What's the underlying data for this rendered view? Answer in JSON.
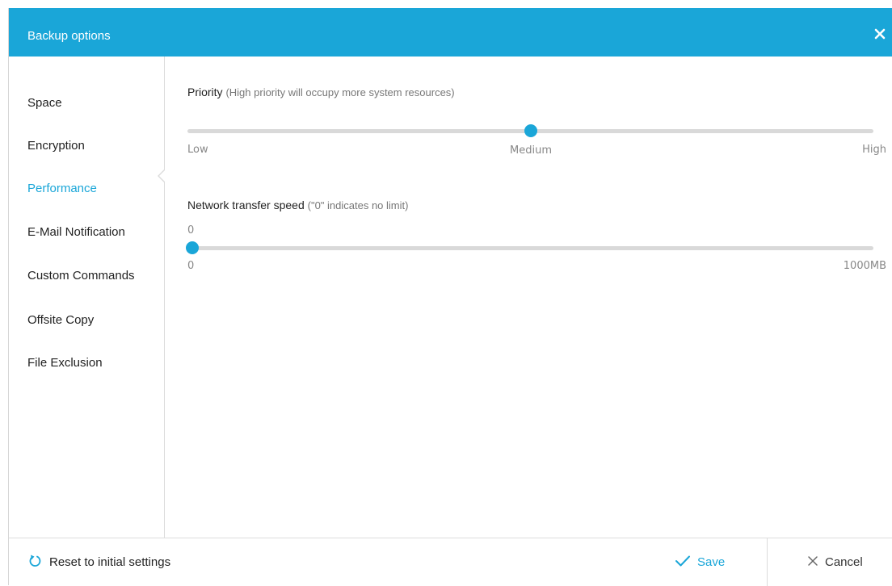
{
  "dialog": {
    "title": "Backup options",
    "close_icon": "close-icon"
  },
  "sidebar": {
    "items": [
      {
        "label": "Space"
      },
      {
        "label": "Encryption"
      },
      {
        "label": "Performance",
        "active": true
      },
      {
        "label": "E-Mail Notification"
      },
      {
        "label": "Custom Commands"
      },
      {
        "label": "Offsite Copy"
      },
      {
        "label": "File Exclusion"
      }
    ]
  },
  "performance": {
    "priority": {
      "label": "Priority",
      "hint": "(High priority will occupy more system resources)",
      "min_label": "Low",
      "mid_label": "Medium",
      "max_label": "High",
      "level": "Medium",
      "value_fraction": 0.5
    },
    "network_speed": {
      "label": "Network transfer speed",
      "hint": "(\"0\" indicates no limit)",
      "current_value": "0",
      "min_label": "0",
      "max_label": "1000MB",
      "value": 0,
      "max": 1000
    }
  },
  "footer": {
    "reset_label": "Reset to initial settings",
    "reset_icon": "refresh-icon",
    "save_label": "Save",
    "save_icon": "checkmark-icon",
    "cancel_label": "Cancel",
    "cancel_icon": "close-icon"
  },
  "colors": {
    "accent": "#1aa6d8",
    "track": "#d9d9d9",
    "border": "#dcdcdc"
  }
}
